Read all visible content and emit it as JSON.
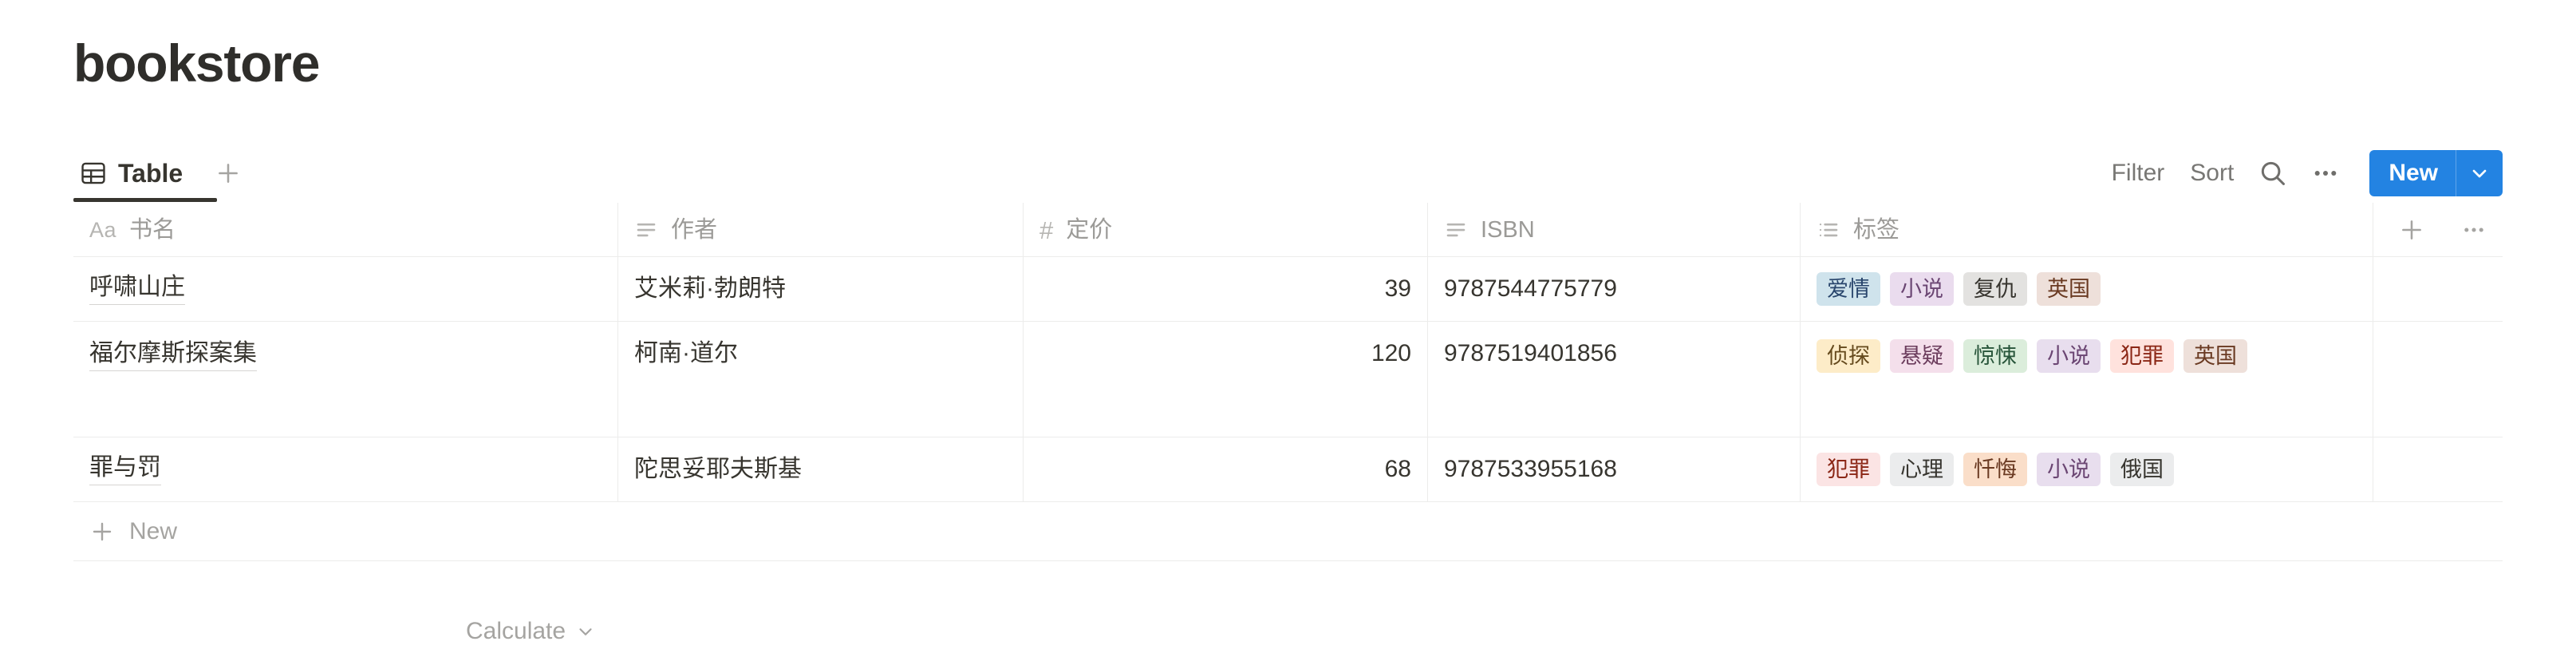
{
  "page": {
    "title": "bookstore"
  },
  "viewbar": {
    "tabs": [
      {
        "label": "Table",
        "icon": "table-icon",
        "active": true
      }
    ],
    "add_view_icon": "plus-icon",
    "tools": [
      {
        "name": "filter",
        "label": "Filter"
      },
      {
        "name": "sort",
        "label": "Sort"
      },
      {
        "name": "search",
        "icon": "search-icon"
      },
      {
        "name": "more",
        "icon": "ellipsis-icon"
      }
    ],
    "new_button": {
      "label": "New",
      "caret_icon": "chevron-down-icon",
      "color": "#2383e2"
    }
  },
  "table": {
    "columns": [
      {
        "key": "title",
        "label": "书名",
        "type": "title",
        "icon": "aa-icon"
      },
      {
        "key": "author",
        "label": "作者",
        "type": "text",
        "icon": "text-lines-icon"
      },
      {
        "key": "price",
        "label": "定价",
        "type": "number",
        "icon": "hash-icon"
      },
      {
        "key": "isbn",
        "label": "ISBN",
        "type": "text",
        "icon": "text-lines-icon"
      },
      {
        "key": "tags",
        "label": "标签",
        "type": "multi-select",
        "icon": "list-icon"
      }
    ],
    "header_actions": [
      {
        "name": "add-column",
        "icon": "plus-icon"
      },
      {
        "name": "column-options",
        "icon": "ellipsis-icon"
      }
    ],
    "rows": [
      {
        "title": "呼啸山庄",
        "author": "艾米莉·勃朗特",
        "price": "39",
        "isbn": "9787544775779",
        "tags": [
          {
            "label": "爱情",
            "bg": "#cfe3ec",
            "fg": "#28456c"
          },
          {
            "label": "小说",
            "bg": "#eadcee",
            "fg": "#6b4673"
          },
          {
            "label": "复仇",
            "bg": "#e3e2e0",
            "fg": "#37352f"
          },
          {
            "label": "英国",
            "bg": "#eee0da",
            "fg": "#6a3a22"
          }
        ]
      },
      {
        "title": "福尔摩斯探案集",
        "author": "柯南·道尔",
        "price": "120",
        "isbn": "9787519401856",
        "tags": [
          {
            "label": "侦探",
            "bg": "#fdecc8",
            "fg": "#654a1d"
          },
          {
            "label": "悬疑",
            "bg": "#f4dfeb",
            "fg": "#6b3c5c"
          },
          {
            "label": "惊悚",
            "bg": "#dbeddb",
            "fg": "#28553a"
          },
          {
            "label": "小说",
            "bg": "#e8deee",
            "fg": "#6b4673"
          },
          {
            "label": "犯罪",
            "bg": "#ffe2dd",
            "fg": "#8b2716"
          },
          {
            "label": "英国",
            "bg": "#eee0da",
            "fg": "#6a3a22"
          }
        ]
      },
      {
        "title": "罪与罚",
        "author": "陀思妥耶夫斯基",
        "price": "68",
        "isbn": "9787533955168",
        "tags": [
          {
            "label": "犯罪",
            "bg": "#fbe4e4",
            "fg": "#8b2716"
          },
          {
            "label": "心理",
            "bg": "#ebeced",
            "fg": "#37352f"
          },
          {
            "label": "忏悔",
            "bg": "#fadec9",
            "fg": "#6a3a22"
          },
          {
            "label": "小说",
            "bg": "#e8deee",
            "fg": "#6b4673"
          },
          {
            "label": "俄国",
            "bg": "#ebeced",
            "fg": "#37352f"
          }
        ]
      }
    ],
    "new_row": {
      "label": "New",
      "icon": "plus-icon"
    },
    "footer": {
      "calculate_label": "Calculate",
      "caret_icon": "chevron-down-icon"
    }
  }
}
